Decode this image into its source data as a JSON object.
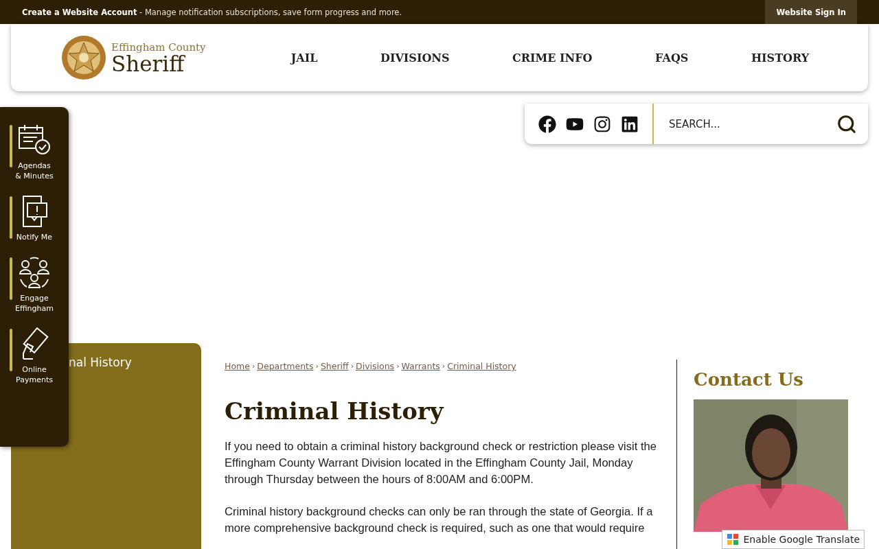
{
  "top_bar": {
    "link": "Create a Website Account",
    "text": " - Manage notification subscriptions, save form progress and more.",
    "sign_in": "Website Sign In"
  },
  "logo": {
    "line1": "Effingham County",
    "line2": "Sheriff"
  },
  "nav": [
    {
      "label": "JAIL"
    },
    {
      "label": "DIVISIONS"
    },
    {
      "label": "CRIME INFO"
    },
    {
      "label": "FAQS"
    },
    {
      "label": "HISTORY"
    }
  ],
  "social": [
    {
      "kind": "facebook"
    },
    {
      "kind": "youtube"
    },
    {
      "kind": "instagram"
    },
    {
      "kind": "linkedin"
    }
  ],
  "search": {
    "placeholder": "SEARCH..."
  },
  "quick_links": [
    {
      "kind": "calendar",
      "label": "Agendas\n& Minutes"
    },
    {
      "kind": "notify",
      "label": "Notify Me"
    },
    {
      "kind": "people",
      "label": "Engage\nEffingham"
    },
    {
      "kind": "payment",
      "label": "Online\nPayments"
    }
  ],
  "side_panel": {
    "title": "nal History"
  },
  "breadcrumbs": [
    {
      "kind": "link",
      "text": "Home"
    },
    {
      "kind": "separator",
      "text": "›"
    },
    {
      "kind": "link",
      "text": "Departments"
    },
    {
      "kind": "separator",
      "text": "›"
    },
    {
      "kind": "link",
      "text": "Sheriff"
    },
    {
      "kind": "separator",
      "text": "›"
    },
    {
      "kind": "link",
      "text": "Divisions"
    },
    {
      "kind": "separator",
      "text": "›"
    },
    {
      "kind": "link",
      "text": "Warrants"
    },
    {
      "kind": "separator",
      "text": "›"
    },
    {
      "kind": "link",
      "text": "Criminal History"
    }
  ],
  "page_title": "Criminal History",
  "paragraphs": [
    "If you need to obtain a criminal history background check or restriction please visit the Effingham County Warrant Division located in the Effingham County Jail, Monday through Thursday between the hours of 8:00AM and 6:00PM.",
    "Criminal history background checks can only be ran through the state of Georgia. If a more comprehensive background check is required, such as one that would require"
  ],
  "contact": {
    "title": "Contact Us"
  },
  "translate": {
    "label": "Enable Google Translate"
  }
}
